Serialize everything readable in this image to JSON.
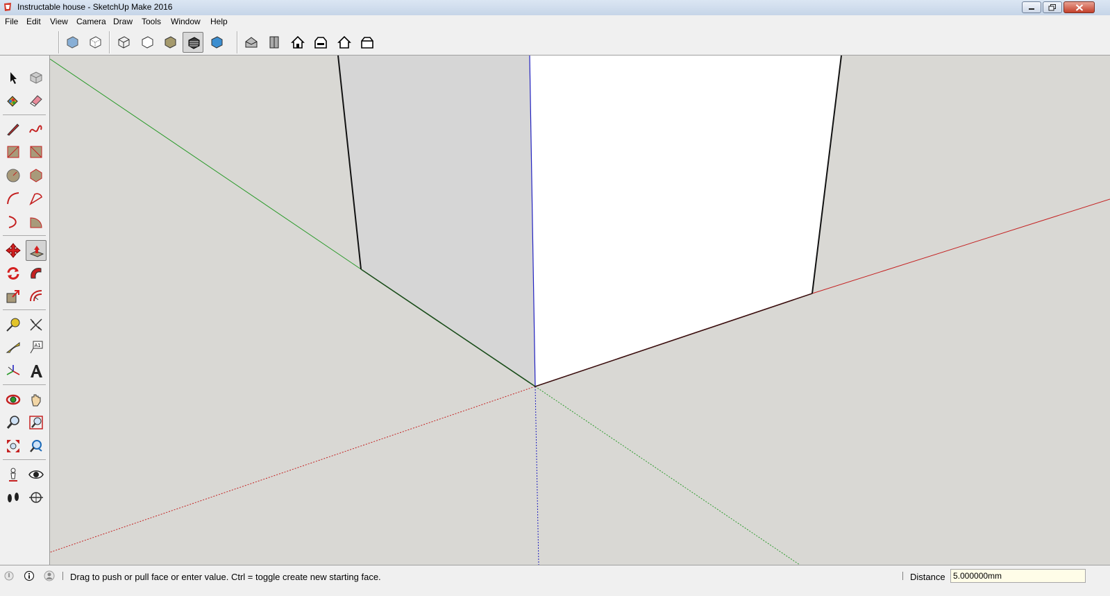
{
  "window": {
    "title": "Instructable house - SketchUp Make 2016"
  },
  "menu": {
    "items": [
      "File",
      "Edit",
      "View",
      "Camera",
      "Draw",
      "Tools",
      "Window",
      "Help"
    ]
  },
  "toolbar": {
    "styles": [
      "xray-style-icon",
      "back-edges-style-icon",
      "wireframe-style-icon",
      "hidden-line-style-icon",
      "shaded-style-icon",
      "shaded-with-textures-style-icon",
      "monochrome-style-icon"
    ],
    "views": [
      "iso-view-icon",
      "top-view-icon",
      "front-view-icon",
      "right-view-icon",
      "back-view-icon",
      "left-view-icon"
    ],
    "active_style": "shaded-with-textures-style-icon"
  },
  "palette": {
    "active_tool": "push-pull-tool"
  },
  "statusbar": {
    "message": "Drag to push or pull face or enter value.  Ctrl = toggle create new starting face.",
    "vcb_label": "Distance",
    "vcb_value": "5.000000mm"
  },
  "colors": {
    "viewport_bg": "#d9d8d4",
    "face_front": "#ffffff",
    "face_side": "#d6d6d6",
    "red_axis": "#c42020",
    "green_axis": "#2a9a2a",
    "blue_axis": "#2020c0"
  }
}
